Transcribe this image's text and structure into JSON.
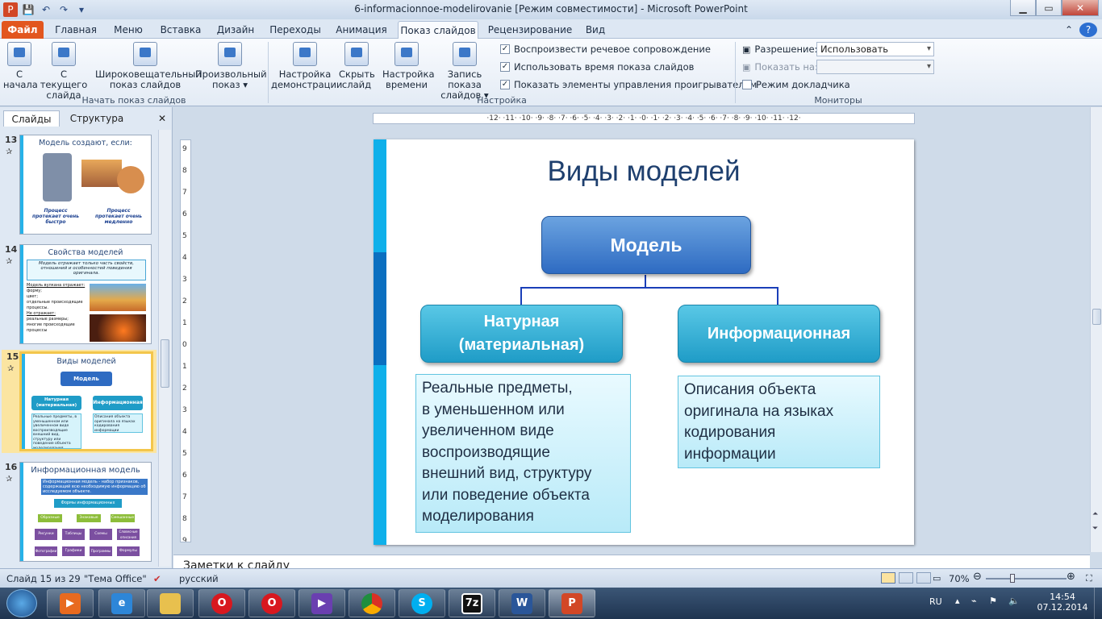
{
  "window": {
    "title": "6-informacionnoe-modelirovanie [Режим совместимости]  -  Microsoft PowerPoint",
    "min": "▁",
    "max": "▭",
    "close": "✕"
  },
  "tabs": [
    "Файл",
    "Главная",
    "Меню",
    "Вставка",
    "Дизайн",
    "Переходы",
    "Анимация",
    "Показ слайдов",
    "Рецензирование",
    "Вид"
  ],
  "ribbon": {
    "groups": {
      "start": "Начать показ слайдов",
      "setup": "Настройка",
      "monitors": "Мониторы"
    },
    "buttons": {
      "from_start": "С\nначала",
      "from_current": "С текущего\nслайда",
      "broadcast": "Широковещательный\nпоказ слайдов",
      "custom": "Произвольный\nпоказ ▾",
      "setup_show": "Настройка\nдемонстрации",
      "hide_slide": "Скрыть\nслайд",
      "rehearse": "Настройка\nвремени",
      "record": "Запись показа\nслайдов ▾"
    },
    "checks": {
      "narrations": "Воспроизвести речевое сопровождение",
      "timings": "Использовать время показа слайдов",
      "media_controls": "Показать элементы управления проигрывателем"
    },
    "monitors": {
      "resolution_label": "Разрешение:",
      "resolution_value": "Использовать текуще...",
      "show_on_label": "Показать на:",
      "presenter_view": "Режим докладчика"
    }
  },
  "pane": {
    "tab_slides": "Слайды",
    "tab_outline": "Структура",
    "close": "✕",
    "thumbs": [
      {
        "num": "13",
        "title": "Модель создают, если:",
        "cap1": "Процесс протекает очень быстро",
        "cap2": "Процесс протекает очень медленно"
      },
      {
        "num": "14",
        "title": "Свойства моделей",
        "lead": "Модель отражает только часть свойств, отношений и особенностей поведения оригинала.",
        "l1": "Модель вулкана отражает:",
        "b1": "форму;",
        "b2": "цвет;",
        "b3": "отдельные происходящие процессы.",
        "l2": "Не отражает:",
        "b4": "реальные размеры;",
        "b5": "многие происходящие процессы"
      },
      {
        "num": "15",
        "title": "Виды моделей",
        "m": "Модель",
        "s1": "Натурная (материальная)",
        "s2": "Информационная",
        "d1": "Реальные предметы, в уменьшенном или увеличенном виде воспроизводящие внешний вид, структуру или поведение объекта моделирования",
        "d2": "Описания объекта оригинала на языках кодирования информации"
      },
      {
        "num": "16",
        "title": "Информационная модель",
        "lead": "Информационная модель - набор признаков, содержащий всю необходимую информацию об исследуемом объекте.",
        "top": "Формы информационных моделей",
        "r1": [
          "Образные",
          "Знаковые",
          "Смешанные"
        ],
        "r2": [
          "Рисунки",
          "Таблицы",
          "Схемы",
          "Словесные описания"
        ],
        "r3": [
          "Фотографии",
          "Графики",
          "Программы",
          "Формулы"
        ]
      }
    ]
  },
  "slide": {
    "title": "Виды моделей",
    "root": "Модель",
    "left": "Натурная\n(материальная)",
    "right": "Информационная",
    "left_desc": "Реальные предметы,\nв уменьшенном или\nувеличенном виде\nвоспроизводящие\nвнешний вид, структуру\nили поведение объекта\nмоделирования",
    "right_desc": "Описания объекта\nоригинала на языках\nкодирования\nинформации"
  },
  "ruler": {
    "h": "·12· ·11· ·10· ·9· ·8· ·7· ·6· ·5· ·4· ·3· ·2· ·1· ·0· ·1· ·2· ·3· ·4· ·5· ·6· ·7· ·8· ·9· ·10· ·11· ·12·",
    "v": [
      "9",
      "8",
      "7",
      "6",
      "5",
      "4",
      "3",
      "2",
      "1",
      "0",
      "1",
      "2",
      "3",
      "4",
      "5",
      "6",
      "7",
      "8",
      "9"
    ]
  },
  "notes_label": "Заметки к слайду",
  "status": {
    "slide": "Слайд 15 из 29",
    "theme": "\"Тема Office\"",
    "lang": "русский",
    "zoom": "70%"
  },
  "taskbar": {
    "lang": "RU",
    "time": "14:54",
    "date": "07.12.2014"
  },
  "colors": {
    "accent_bar": "#0fb0ea",
    "accent_bar_dark": "#0b6fc0",
    "root_box": "#2e6bc2",
    "sub_box": "#1f9cc7",
    "connector": "#1a3fb8",
    "file_tab": "#e2561e"
  }
}
